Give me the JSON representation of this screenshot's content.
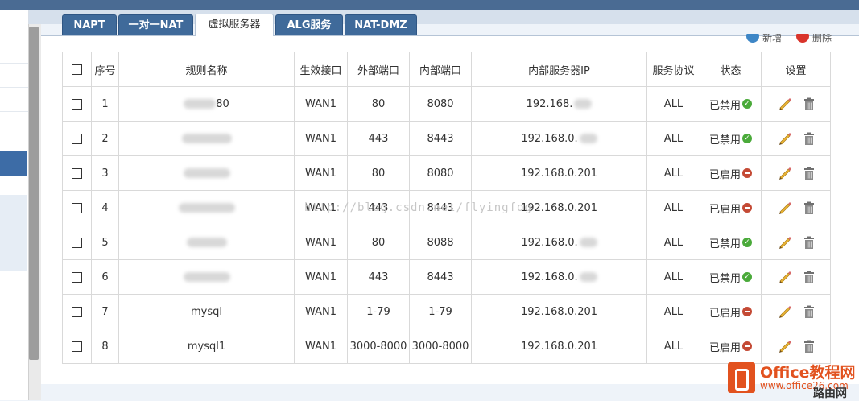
{
  "tabs": [
    {
      "label": "NAPT",
      "active": false
    },
    {
      "label": "一对一NAT",
      "active": false
    },
    {
      "label": "虚拟服务器",
      "active": true
    },
    {
      "label": "ALG服务",
      "active": false
    },
    {
      "label": "NAT-DMZ",
      "active": false
    }
  ],
  "actions": {
    "add_label": "新增",
    "delete_label": "删除"
  },
  "table": {
    "columns": [
      "",
      "序号",
      "规则名称",
      "生效接口",
      "外部端口",
      "内部端口",
      "内部服务器IP",
      "服务协议",
      "状态",
      "设置"
    ],
    "rows": [
      {
        "index": "1",
        "name": "80",
        "iface": "WAN1",
        "ext_port": "80",
        "int_port": "8080",
        "ip": "192.168.",
        "proto": "ALL",
        "status": "已禁用",
        "enabled": false
      },
      {
        "index": "2",
        "name": "",
        "iface": "WAN1",
        "ext_port": "443",
        "int_port": "8443",
        "ip": "192.168.0.",
        "proto": "ALL",
        "status": "已禁用",
        "enabled": false
      },
      {
        "index": "3",
        "name": "",
        "iface": "WAN1",
        "ext_port": "80",
        "int_port": "8080",
        "ip": "192.168.0.201",
        "proto": "ALL",
        "status": "已启用",
        "enabled": true
      },
      {
        "index": "4",
        "name": "",
        "iface": "WAN1",
        "ext_port": "443",
        "int_port": "8443",
        "ip": "192.168.0.201",
        "proto": "ALL",
        "status": "已启用",
        "enabled": true
      },
      {
        "index": "5",
        "name": "",
        "iface": "WAN1",
        "ext_port": "80",
        "int_port": "8088",
        "ip": "192.168.0.",
        "proto": "ALL",
        "status": "已禁用",
        "enabled": false
      },
      {
        "index": "6",
        "name": "",
        "iface": "WAN1",
        "ext_port": "443",
        "int_port": "8443",
        "ip": "192.168.0.",
        "proto": "ALL",
        "status": "已禁用",
        "enabled": false
      },
      {
        "index": "7",
        "name": "mysql",
        "iface": "WAN1",
        "ext_port": "1-79",
        "int_port": "1-79",
        "ip": "192.168.0.201",
        "proto": "ALL",
        "status": "已启用",
        "enabled": true
      },
      {
        "index": "8",
        "name": "mysql1",
        "iface": "WAN1",
        "ext_port": "3000-8000",
        "int_port": "3000-8000",
        "ip": "192.168.0.201",
        "proto": "ALL",
        "status": "已启用",
        "enabled": true
      }
    ]
  },
  "watermark": "http://blog.csdn.net/flyingfog",
  "brand": {
    "title": "Office教程网",
    "url": "www.office26.com",
    "tag": "路由网"
  },
  "colors": {
    "tab_bg": "#3f6a9a",
    "disabled_icon": "#4aaa3a",
    "enabled_icon": "#c44a35",
    "brand": "#e2521f"
  }
}
